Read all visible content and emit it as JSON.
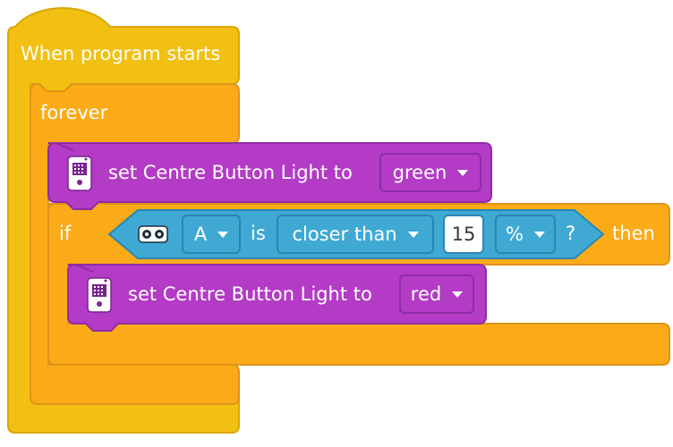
{
  "colors": {
    "events_yellow": "#F2C012",
    "events_edge": "#D8A808",
    "control_orange": "#FBAB18",
    "control_edge": "#E0931A",
    "light_purple": "#B33BC6",
    "light_edge": "#8E2CA6",
    "sensor_teal": "#3FA9D4",
    "sensor_edge": "#2A86B0"
  },
  "hat": {
    "label": "When program starts"
  },
  "forever": {
    "label": "forever"
  },
  "light_green": {
    "icon": "hub-icon",
    "label": "set Centre Button Light to",
    "color_value": "green"
  },
  "if_block": {
    "if_label": "if",
    "then_label": "then",
    "condition": {
      "sensor_icon": "distance-sensor-icon",
      "port": "A",
      "is_label": "is",
      "comparison": "closer than",
      "value": "15",
      "unit": "%",
      "question": "?"
    }
  },
  "light_red": {
    "icon": "hub-icon",
    "label": "set Centre Button Light to",
    "color_value": "red"
  }
}
